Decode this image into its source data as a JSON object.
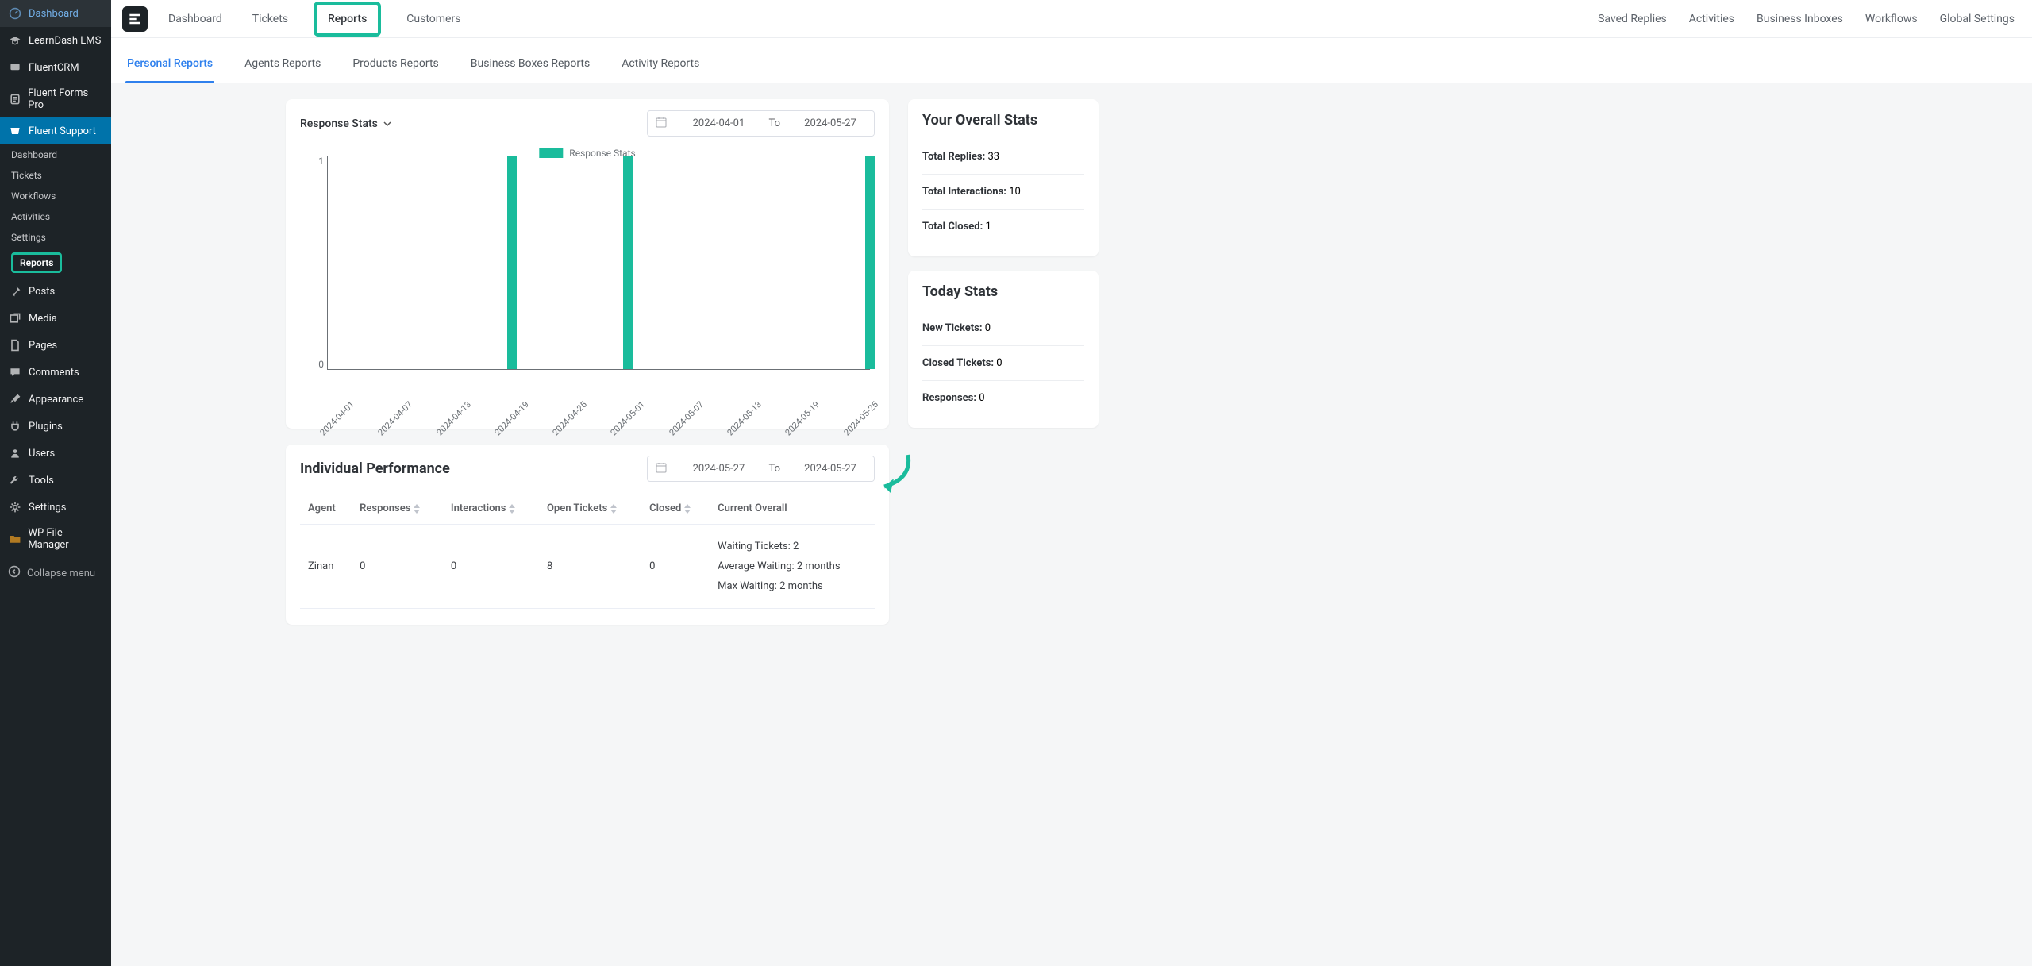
{
  "wp_sidebar": {
    "main": [
      {
        "icon": "dashboard-icon",
        "label": "Dashboard"
      },
      {
        "icon": "cap-icon",
        "label": "LearnDash LMS"
      },
      {
        "icon": "chat-icon",
        "label": "FluentCRM"
      },
      {
        "icon": "form-icon",
        "label": "Fluent Forms Pro"
      },
      {
        "icon": "support-icon",
        "label": "Fluent Support"
      }
    ],
    "sub": [
      {
        "label": "Dashboard"
      },
      {
        "label": "Tickets"
      },
      {
        "label": "Workflows"
      },
      {
        "label": "Activities"
      },
      {
        "label": "Settings"
      },
      {
        "label": "Reports"
      }
    ],
    "tail": [
      {
        "icon": "pin-icon",
        "label": "Posts"
      },
      {
        "icon": "media-icon",
        "label": "Media"
      },
      {
        "icon": "page-icon",
        "label": "Pages"
      },
      {
        "icon": "comment-icon",
        "label": "Comments"
      },
      {
        "icon": "brush-icon",
        "label": "Appearance"
      },
      {
        "icon": "plug-icon",
        "label": "Plugins"
      },
      {
        "icon": "user-icon",
        "label": "Users"
      },
      {
        "icon": "wrench-icon",
        "label": "Tools"
      },
      {
        "icon": "gear-icon",
        "label": "Settings"
      },
      {
        "icon": "folder-icon",
        "label": "WP File Manager"
      }
    ],
    "collapse": "Collapse menu"
  },
  "top_tabs": [
    "Dashboard",
    "Tickets",
    "Reports",
    "Customers"
  ],
  "top_links": [
    "Saved Replies",
    "Activities",
    "Business Inboxes",
    "Workflows",
    "Global Settings"
  ],
  "sub_tabs": [
    "Personal Reports",
    "Agents Reports",
    "Products Reports",
    "Business Boxes Reports",
    "Activity Reports"
  ],
  "chart": {
    "dropdown_label": "Response Stats",
    "date_from": "2024-04-01",
    "date_to_label": "To",
    "date_to": "2024-05-27"
  },
  "perf": {
    "title": "Individual Performance",
    "date_from": "2024-05-27",
    "date_to_label": "To",
    "date_to": "2024-05-27",
    "cols": [
      "Agent",
      "Responses",
      "Interactions",
      "Open Tickets",
      "Closed",
      "Current Overall"
    ],
    "row": {
      "agent": "Zinan",
      "responses": "0",
      "interactions": "0",
      "open": "8",
      "closed": "0",
      "overall_waiting": "Waiting Tickets: 2",
      "overall_avg": "Average Waiting: 2 months",
      "overall_max": "Max Waiting: 2 months"
    }
  },
  "overall": {
    "title": "Your Overall Stats",
    "rows": [
      {
        "label": "Total Replies:",
        "value": "33"
      },
      {
        "label": "Total Interactions:",
        "value": "10"
      },
      {
        "label": "Total Closed:",
        "value": "1"
      }
    ]
  },
  "today": {
    "title": "Today Stats",
    "rows": [
      {
        "label": "New Tickets:",
        "value": "0"
      },
      {
        "label": "Closed Tickets:",
        "value": "0"
      },
      {
        "label": "Responses:",
        "value": "0"
      }
    ]
  },
  "chart_data": {
    "type": "bar",
    "title": "Response Stats",
    "legend": "Response Stats",
    "ylim": [
      0,
      1
    ],
    "yticks": [
      0,
      1
    ],
    "x_tick_labels": [
      "2024-04-01",
      "2024-04-07",
      "2024-04-13",
      "2024-04-19",
      "2024-04-25",
      "2024-05-01",
      "2024-05-07",
      "2024-05-13",
      "2024-05-19",
      "2024-05-25"
    ],
    "data_points": [
      {
        "x": "2024-04-20",
        "y": 1
      },
      {
        "x": "2024-05-02",
        "y": 1
      },
      {
        "x": "2024-05-27",
        "y": 1
      }
    ]
  }
}
